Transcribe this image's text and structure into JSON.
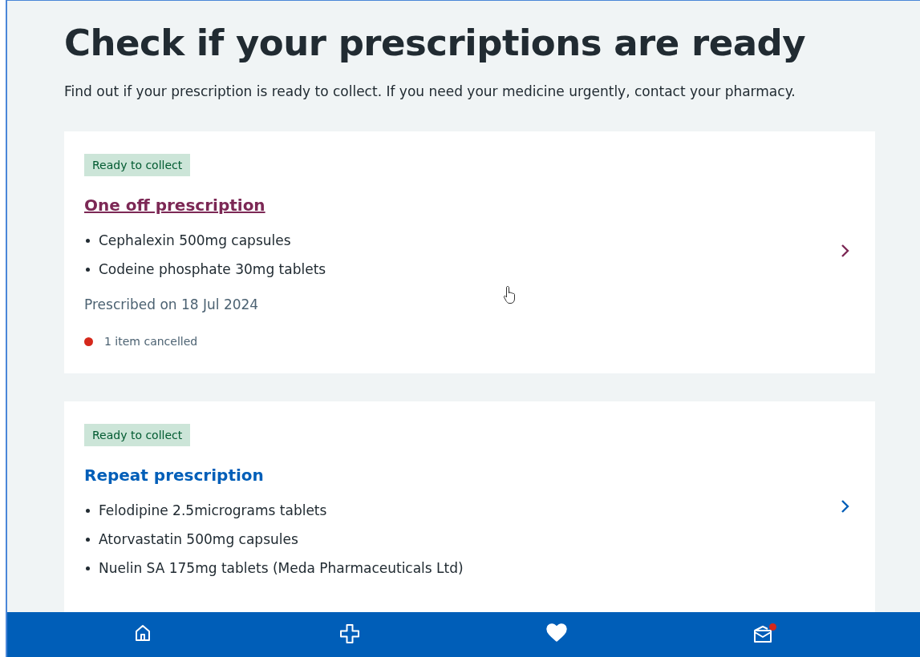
{
  "page": {
    "title": "Check if your prescriptions are ready",
    "intro": "Find out if your prescription is ready to collect. If you need your medicine urgently, contact your pharmacy."
  },
  "prescriptions": [
    {
      "status": "Ready to collect",
      "title": "One off prescription",
      "visited": true,
      "items": [
        "Cephalexin 500mg capsules",
        "Codeine phosphate 30mg tablets"
      ],
      "prescribed": "Prescribed on 18 Jul 2024",
      "note": {
        "text": "1 item cancelled",
        "color": "#d5281b"
      }
    },
    {
      "status": "Ready to collect",
      "title": "Repeat prescription",
      "visited": false,
      "items": [
        "Felodipine 2.5micrograms tablets",
        "Atorvastatin 500mg capsules",
        "Nuelin SA 175mg tablets (Meda Pharmaceuticals Ltd)"
      ]
    }
  ],
  "nav": [
    {
      "kind": "home",
      "notification": false
    },
    {
      "kind": "services",
      "notification": false
    },
    {
      "kind": "health",
      "notification": false
    },
    {
      "kind": "messages",
      "notification": true
    }
  ]
}
